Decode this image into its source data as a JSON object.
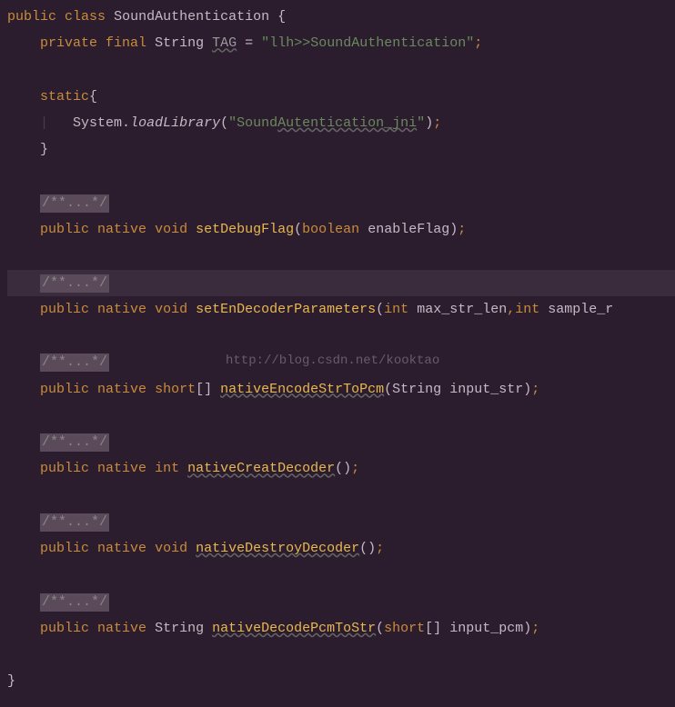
{
  "watermark": "http://blog.csdn.net/kooktao",
  "code": {
    "line1": {
      "kw_public": "public",
      "kw_class": "class",
      "class_name": "SoundAuthentication",
      "brace": "{"
    },
    "line2": {
      "kw_private": "private",
      "kw_final": "final",
      "type": "String",
      "field": "TAG",
      "eq": "=",
      "str_open": "\"",
      "str_val": "llh>>SoundAuthentication",
      "str_close": "\"",
      "semi": ";"
    },
    "line4": {
      "kw_static": "static",
      "brace": "{"
    },
    "line5": {
      "obj": "System.",
      "method": "loadLibrary",
      "paren_o": "(",
      "str_open": "\"",
      "str_pre": "Sound",
      "str_warn": "Autentication_jni",
      "str_close": "\"",
      "paren_c": ")",
      "semi": ";"
    },
    "line6": {
      "brace": "}"
    },
    "comment": "/**...*/",
    "method1": {
      "kw_public": "public",
      "kw_native": "native",
      "kw_void": "void",
      "name": "setDebugFlag",
      "paren_o": "(",
      "kw_boolean": "boolean",
      "param": "enableFlag",
      "paren_c": ")",
      "semi": ";"
    },
    "method2": {
      "kw_public": "public",
      "kw_native": "native",
      "kw_void": "void",
      "name": "setEnDecoderParameters",
      "paren_o": "(",
      "kw_int1": "int",
      "param1": "max_str_len",
      "comma": ",",
      "kw_int2": "int",
      "param2": "sample_r"
    },
    "method3": {
      "kw_public": "public",
      "kw_native": "native",
      "kw_short": "short",
      "brackets": "[]",
      "name": "nativeEncodeStrToPcm",
      "paren_o": "(",
      "type": "String",
      "param": "input_str",
      "paren_c": ")",
      "semi": ";"
    },
    "method4": {
      "kw_public": "public",
      "kw_native": "native",
      "kw_int": "int",
      "name": "nativeCreatDecoder",
      "paren_o": "(",
      "paren_c": ")",
      "semi": ";"
    },
    "method5": {
      "kw_public": "public",
      "kw_native": "native",
      "kw_void": "void",
      "name": "nativeDestroyDecoder",
      "paren_o": "(",
      "paren_c": ")",
      "semi": ";"
    },
    "method6": {
      "kw_public": "public",
      "kw_native": "native",
      "type": "String",
      "name": "nativeDecodePcmToStr",
      "paren_o": "(",
      "kw_short": "short",
      "brackets": "[]",
      "param": "input_pcm",
      "paren_c": ")",
      "semi": ";"
    },
    "close_brace": "}"
  }
}
